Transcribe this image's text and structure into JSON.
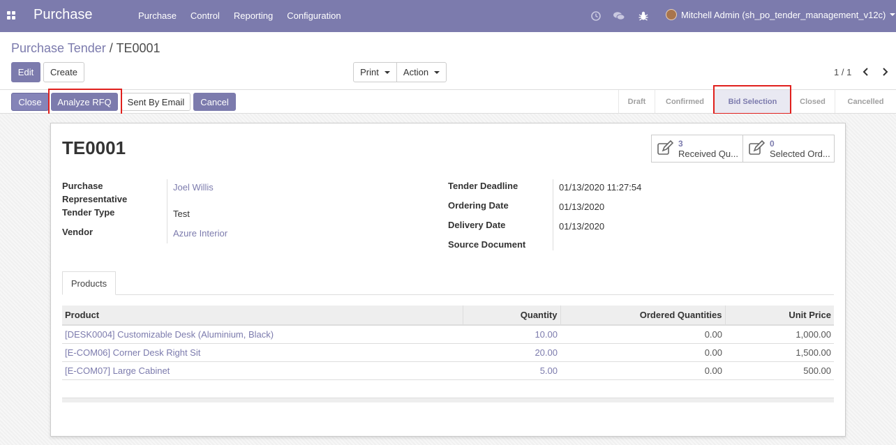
{
  "navbar": {
    "brand": "Purchase",
    "menu": [
      "Purchase",
      "Control",
      "Reporting",
      "Configuration"
    ],
    "user": "Mitchell Admin (sh_po_tender_management_v12c)",
    "icons": [
      "clock-icon",
      "chat-icon",
      "bug-icon"
    ]
  },
  "breadcrumb": {
    "parent": "Purchase Tender",
    "separator": "/",
    "current": "TE0001"
  },
  "buttons": {
    "edit": "Edit",
    "create": "Create",
    "print": "Print",
    "action": "Action"
  },
  "pager": {
    "value": "1 / 1"
  },
  "statusbar": {
    "buttons": {
      "close": "Close",
      "analyze": "Analyze RFQ",
      "sent_email": "Sent By Email",
      "cancel": "Cancel"
    },
    "states": [
      "Draft",
      "Confirmed",
      "Bid Selection",
      "Closed",
      "Cancelled"
    ],
    "current_state": "Bid Selection"
  },
  "record": {
    "title": "TE0001",
    "smart_buttons": [
      {
        "count": "3",
        "label": "Received Qu..."
      },
      {
        "count": "0",
        "label": "Selected Ord..."
      }
    ],
    "left_fields": {
      "rep_label_1": "Purchase",
      "rep_label_2": "Representative",
      "rep_value": "Joel Willis",
      "type_label": "Tender Type",
      "type_value": "Test",
      "vendor_label": "Vendor",
      "vendor_value": "Azure Interior"
    },
    "right_fields": {
      "deadline_label": "Tender Deadline",
      "deadline_value": "01/13/2020 11:27:54",
      "ordering_label": "Ordering Date",
      "ordering_value": "01/13/2020",
      "delivery_label": "Delivery Date",
      "delivery_value": "01/13/2020",
      "source_label": "Source Document",
      "source_value": ""
    }
  },
  "tabs": {
    "products": "Products"
  },
  "table": {
    "headers": [
      "Product",
      "Quantity",
      "Ordered Quantities",
      "Unit Price"
    ],
    "rows": [
      [
        "[DESK0004] Customizable Desk (Aluminium, Black)",
        "10.00",
        "0.00",
        "1,000.00"
      ],
      [
        "[E-COM06] Corner Desk Right Sit",
        "20.00",
        "0.00",
        "1,500.00"
      ],
      [
        "[E-COM07] Large Cabinet",
        "5.00",
        "0.00",
        "500.00"
      ]
    ]
  },
  "colors": {
    "brand": "#7c7bad",
    "highlight": "#e0201d"
  }
}
